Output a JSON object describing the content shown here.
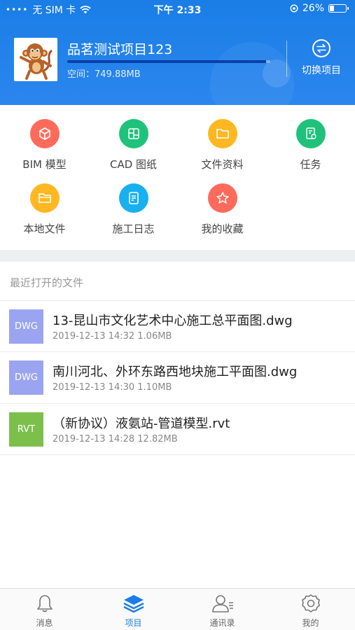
{
  "status_bar": {
    "carrier": "无 SIM 卡",
    "time": "下午 2:33",
    "battery": "26%",
    "battery_level": 0.26
  },
  "header": {
    "project_name": "品茗测试项目123",
    "space_label": "空间：749.88MB",
    "storage_used_fraction": 0.98,
    "switch_label": "切换项目"
  },
  "shortcuts": [
    {
      "label": "BIM 模型",
      "icon": "cube-icon",
      "color": "#ff6b5b"
    },
    {
      "label": "CAD 图纸",
      "icon": "blueprint-icon",
      "color": "#1fc27a"
    },
    {
      "label": "文件资料",
      "icon": "folder-icon",
      "color": "#ffb822"
    },
    {
      "label": "任务",
      "icon": "task-icon",
      "color": "#1fc27a"
    },
    {
      "label": "本地文件",
      "icon": "local-folder-icon",
      "color": "#ffb822"
    },
    {
      "label": "施工日志",
      "icon": "log-icon",
      "color": "#19b0ef"
    },
    {
      "label": "我的收藏",
      "icon": "star-icon",
      "color": "#ff6b5b"
    }
  ],
  "recent": {
    "title": "最近打开的文件",
    "files": [
      {
        "type": "DWG",
        "type_color": "#9aa4f0",
        "name": "13-昆山市文化艺术中心施工总平面图.dwg",
        "meta": "2019-12-13 14:32  1.06MB"
      },
      {
        "type": "DWG",
        "type_color": "#9aa4f0",
        "name": "南川河北、外环东路西地块施工平面图.dwg",
        "meta": "2019-12-13 14:30  1.10MB"
      },
      {
        "type": "RVT",
        "type_color": "#7cc04b",
        "name": "（新协议）液氨站-管道模型.rvt",
        "meta": "2019-12-13 14:28  12.82MB"
      }
    ]
  },
  "tabbar": [
    {
      "label": "消息",
      "icon": "bell-icon",
      "active": false
    },
    {
      "label": "项目",
      "icon": "layers-icon",
      "active": true
    },
    {
      "label": "通讯录",
      "icon": "contacts-icon",
      "active": false
    },
    {
      "label": "我的",
      "icon": "gear-icon",
      "active": false
    }
  ],
  "colors": {
    "primary": "#1a7ee6",
    "background": "#ffffff"
  }
}
